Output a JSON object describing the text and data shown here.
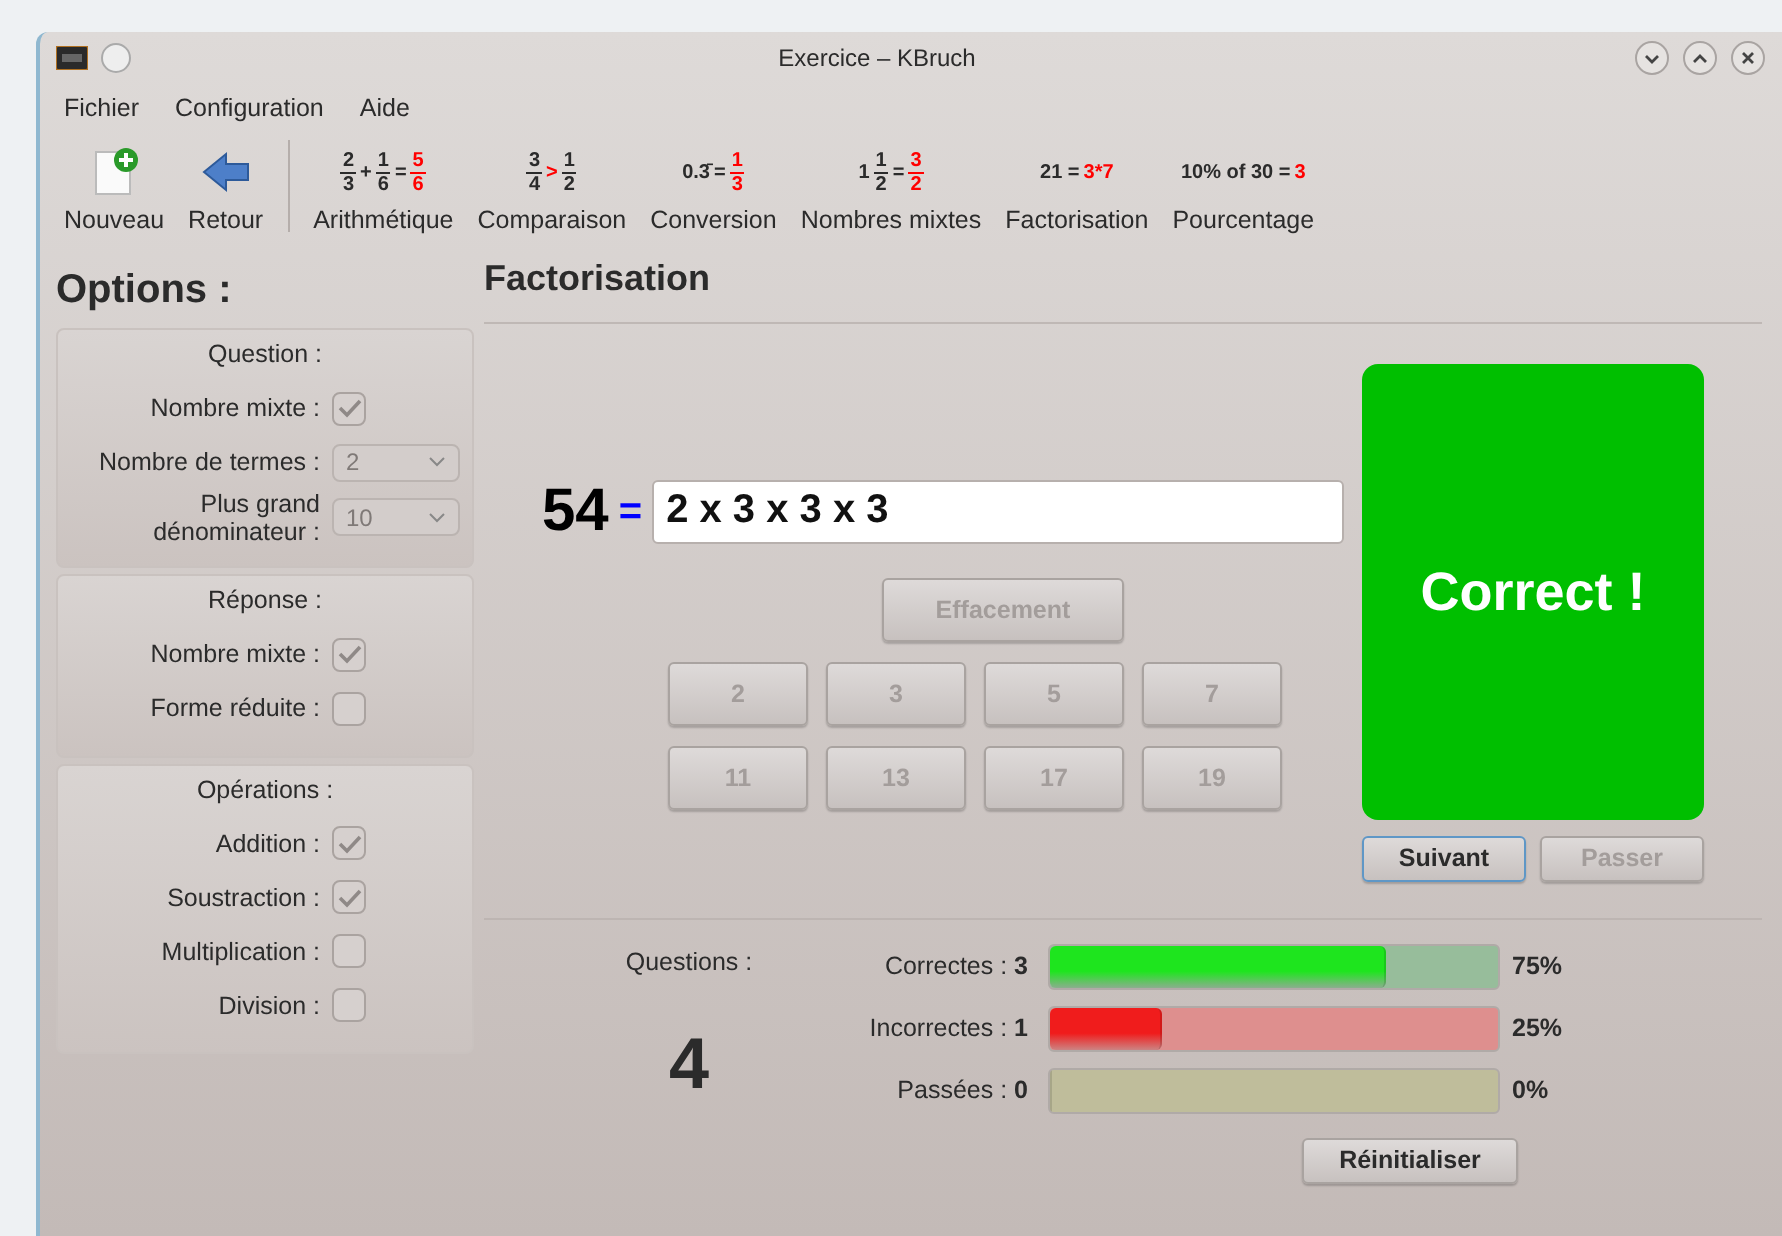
{
  "window": {
    "title": "Exercice – KBruch"
  },
  "menu": [
    "Fichier",
    "Configuration",
    "Aide"
  ],
  "toolbar": [
    {
      "kind": "new",
      "label": "Nouveau"
    },
    {
      "kind": "back",
      "label": "Retour"
    },
    {
      "kind": "exercise",
      "label": "Arithmétique",
      "formula": [
        {
          "kind": "frac",
          "num": "2",
          "den": "3",
          "answer": false
        },
        {
          "kind": "op",
          "text": "+",
          "answer": false
        },
        {
          "kind": "frac",
          "num": "1",
          "den": "6",
          "answer": false
        },
        {
          "kind": "op",
          "text": "=",
          "answer": false
        },
        {
          "kind": "frac",
          "num": "5",
          "den": "6",
          "answer": true
        }
      ]
    },
    {
      "kind": "exercise",
      "label": "Comparaison",
      "formula": [
        {
          "kind": "frac",
          "num": "3",
          "den": "4",
          "answer": false
        },
        {
          "kind": "op",
          "text": ">",
          "answer": true
        },
        {
          "kind": "frac",
          "num": "1",
          "den": "2",
          "answer": false
        }
      ]
    },
    {
      "kind": "exercise",
      "label": "Conversion",
      "formula": [
        {
          "kind": "op",
          "text": "0.3̄",
          "answer": false
        },
        {
          "kind": "op",
          "text": "=",
          "answer": false
        },
        {
          "kind": "frac",
          "num": "1",
          "den": "3",
          "answer": true
        }
      ]
    },
    {
      "kind": "exercise",
      "label": "Nombres mixtes",
      "formula": [
        {
          "kind": "op",
          "text": "1",
          "answer": false
        },
        {
          "kind": "frac",
          "num": "1",
          "den": "2",
          "answer": false
        },
        {
          "kind": "op",
          "text": "=",
          "answer": false
        },
        {
          "kind": "frac",
          "num": "3",
          "den": "2",
          "answer": true
        }
      ]
    },
    {
      "kind": "exercise",
      "label": "Factorisation",
      "formula": [
        {
          "kind": "op",
          "text": "21 =",
          "answer": false
        },
        {
          "kind": "op",
          "text": "3*7",
          "answer": true
        }
      ]
    },
    {
      "kind": "exercise",
      "label": "Pourcentage",
      "formula": [
        {
          "kind": "op",
          "text": "10% of 30 =",
          "answer": false
        },
        {
          "kind": "op",
          "text": "3",
          "answer": true
        }
      ]
    }
  ],
  "options": {
    "title": "Options :",
    "groups": [
      {
        "title": "Question :",
        "rows": [
          {
            "kind": "checkbox",
            "label": "Nombre mixte :",
            "checked": true,
            "disabled": true
          },
          {
            "kind": "select",
            "label": "Nombre de termes :",
            "value": "2",
            "disabled": true
          },
          {
            "kind": "select",
            "label": "Plus grand dénominateur :",
            "value": "10",
            "disabled": true
          }
        ]
      },
      {
        "title": "Réponse :",
        "rows": [
          {
            "kind": "checkbox",
            "label": "Nombre mixte :",
            "checked": true,
            "disabled": true
          },
          {
            "kind": "checkbox",
            "label": "Forme réduite :",
            "checked": false,
            "disabled": true
          }
        ]
      },
      {
        "title": "Opérations :",
        "rows": [
          {
            "kind": "checkbox",
            "label": "Addition :",
            "checked": true,
            "disabled": true
          },
          {
            "kind": "checkbox",
            "label": "Soustraction :",
            "checked": true,
            "disabled": true
          },
          {
            "kind": "checkbox",
            "label": "Multiplication :",
            "checked": false,
            "disabled": true
          },
          {
            "kind": "checkbox",
            "label": "Division :",
            "checked": false,
            "disabled": true
          }
        ]
      }
    ]
  },
  "exercise": {
    "title": "Factorisation",
    "number": "54",
    "equals": "=",
    "answer": "2 x 3 x 3 x 3",
    "clear_button": {
      "label": "Effacement",
      "disabled": true
    },
    "primes": [
      {
        "label": "2",
        "disabled": true
      },
      {
        "label": "3",
        "disabled": true
      },
      {
        "label": "5",
        "disabled": true
      },
      {
        "label": "7",
        "disabled": true
      },
      {
        "label": "11",
        "disabled": true
      },
      {
        "label": "13",
        "disabled": true
      },
      {
        "label": "17",
        "disabled": true
      },
      {
        "label": "19",
        "disabled": true
      }
    ],
    "result": {
      "kind": "correct",
      "text": "Correct !"
    },
    "buttons": [
      {
        "label": "Suivant",
        "disabled": false,
        "focused": true
      },
      {
        "label": "Passer",
        "disabled": true,
        "focused": false
      }
    ]
  },
  "stats": {
    "questions_label": "Questions :",
    "questions_count": "4",
    "rows": [
      {
        "kind": "correct",
        "label": "Correctes :",
        "count": "3",
        "level": 0.75,
        "reading": "75%"
      },
      {
        "kind": "incorrect",
        "label": "Incorrectes :",
        "count": "1",
        "level": 0.25,
        "reading": "25%"
      },
      {
        "kind": "skipped",
        "label": "Passées :",
        "count": "0",
        "level": 0,
        "reading": "0%"
      }
    ],
    "reset_button": "Réinitialiser"
  }
}
